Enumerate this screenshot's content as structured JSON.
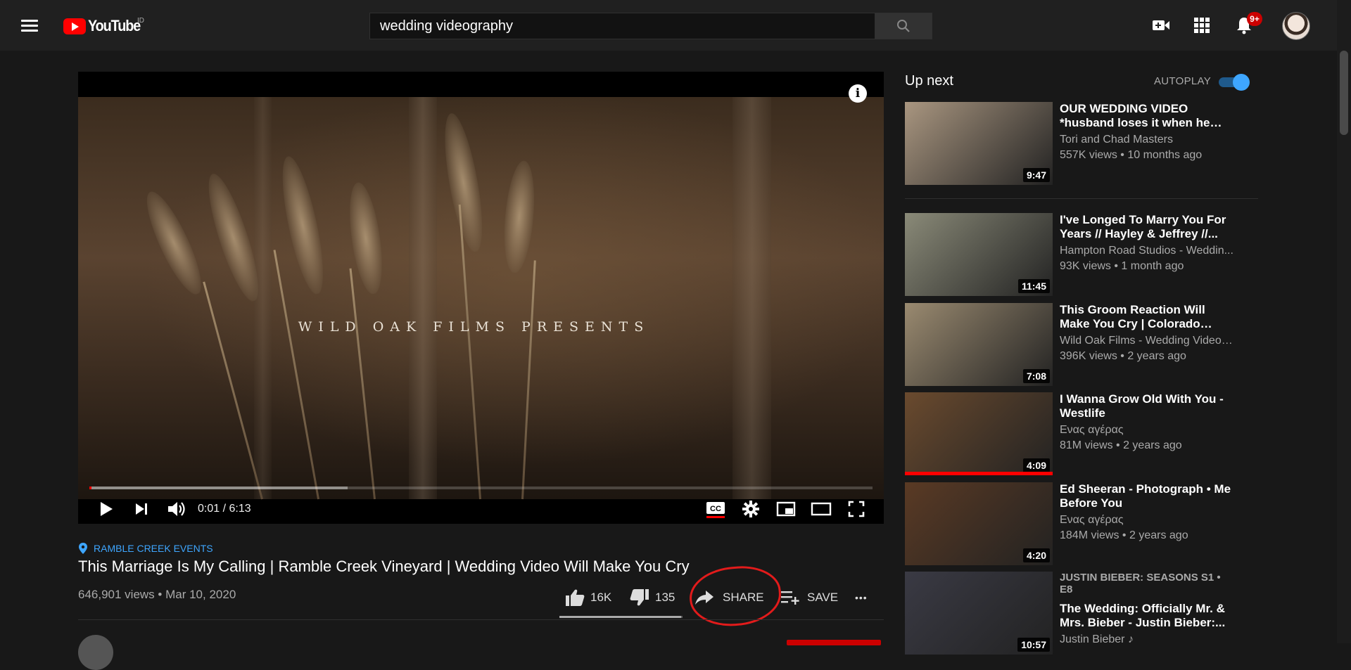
{
  "header": {
    "logo_text": "YouTube",
    "region": "ID",
    "search_value": "wedding videography",
    "notification_count": "9+"
  },
  "player": {
    "overlay_text": "WILD OAK FILMS PRESENTS",
    "info_label": "i",
    "time": "0:01 / 6:13",
    "progress_played": 0.003,
    "progress_loaded": 0.33,
    "captions_on": true
  },
  "video": {
    "location": "RAMBLE CREEK EVENTS",
    "title": "This Marriage Is My Calling | Ramble Creek Vineyard | Wedding Video Will Make You Cry",
    "views": "646,901 views",
    "date": "Mar 10, 2020",
    "likes": "16K",
    "dislikes": "135",
    "like_ratio": 0.99,
    "share_label": "SHARE",
    "save_label": "SAVE",
    "more_label": "•••"
  },
  "sidebar": {
    "header": "Up next",
    "autoplay_label": "AUTOPLAY",
    "autoplay_on": true,
    "items": [
      {
        "title": "OUR WEDDING VIDEO *husband loses it when he sees her*",
        "channel": "Tori and Chad Masters",
        "views": "557K views",
        "age": "10 months ago",
        "duration": "9:47",
        "thumb_color": "#a99680"
      },
      {
        "title": "I've Longed To Marry You For Years // Hayley & Jeffrey //...",
        "channel": "Hampton Road Studios - Weddin...",
        "views": "93K views",
        "age": "1 month ago",
        "duration": "11:45",
        "thumb_color": "#8a8a78"
      },
      {
        "title": "This Groom Reaction Will Make You Cry | Colorado Wedding...",
        "channel": "Wild Oak Films - Wedding Video, ...",
        "views": "396K views",
        "age": "2 years ago",
        "duration": "7:08",
        "thumb_color": "#9a8a70"
      },
      {
        "title": "I Wanna Grow Old With You - Westlife",
        "channel": "Ενας αγέρας",
        "views": "81M views",
        "age": "2 years ago",
        "duration": "4:09",
        "thumb_color": "#6a4a2e",
        "watched": true
      },
      {
        "title": "Ed Sheeran - Photograph • Me Before You",
        "channel": "Ενας αγέρας",
        "views": "184M views",
        "age": "2 years ago",
        "duration": "4:20",
        "thumb_color": "#5a3a24"
      },
      {
        "top_label": "JUSTIN BIEBER: SEASONS  S1 • E8",
        "title": "The Wedding: Officially Mr. & Mrs. Bieber - Justin Bieber:...",
        "channel": "Justin Bieber ♪",
        "duration": "10:57",
        "thumb_color": "#3a3a44"
      }
    ]
  }
}
